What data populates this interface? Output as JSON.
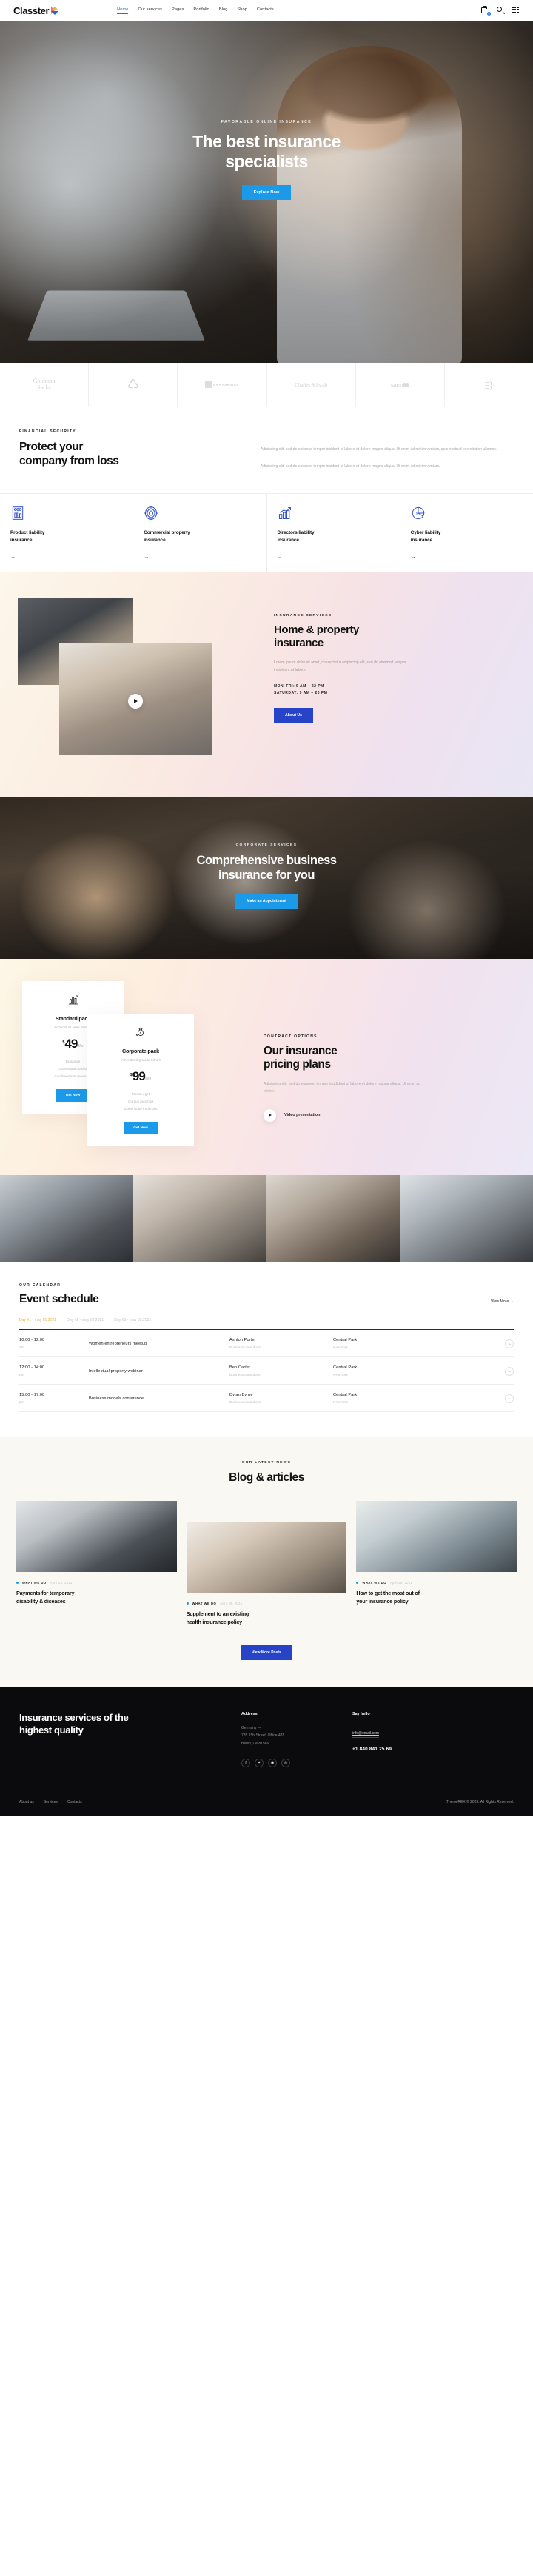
{
  "header": {
    "logo_text": "Classter",
    "nav": [
      {
        "label": "Home",
        "active": true
      },
      {
        "label": "Our services",
        "active": false
      },
      {
        "label": "Pages",
        "active": false
      },
      {
        "label": "Portfolio",
        "active": false
      },
      {
        "label": "Blog",
        "active": false
      },
      {
        "label": "Shop",
        "active": false
      },
      {
        "label": "Contacts",
        "active": false
      }
    ],
    "cart_count": "0",
    "icons": [
      "cart-icon",
      "search-icon",
      "grid-menu-icon"
    ]
  },
  "hero": {
    "kicker": "FAVORABLE ONLINE INSURANCE",
    "title_line1": "The best insurance",
    "title_line2": "specialists",
    "cta": "Explore Now"
  },
  "brands": [
    {
      "name": "Goldman Sachs",
      "line1": "Goldman",
      "line2": "Sachs"
    },
    {
      "name": "recycle-logo",
      "line1": "",
      "line2": ""
    },
    {
      "name": "BNP PARIBAS",
      "line1": "BNP PARIBAS",
      "line2": ""
    },
    {
      "name": "Charles Schwab",
      "line1": "Charles Schwab",
      "line2": ""
    },
    {
      "name": "sam",
      "line1": "sam",
      "line2": ""
    },
    {
      "name": "bars-logo",
      "line1": "",
      "line2": ""
    }
  ],
  "financial": {
    "kicker": "FINANCIAL SECURITY",
    "title_line1": "Protect your",
    "title_line2": "company from loss",
    "para1": "Adipiscing elit, sed do euismod tempor incidunt ut labore et dolore magna aliqua. Ut enim ad minim veniam, quis nostrud exercitation ullamco.",
    "para2": "Adipiscing elit, sed do euismod tempor incidunt ut labore et dolore magna aliqua. Ut enim ad minim veniam.",
    "features": [
      {
        "icon": "chart-bars-money-icon",
        "title_line1": "Product liability",
        "title_line2": "insurance",
        "arrow": "→"
      },
      {
        "icon": "target-dollar-icon",
        "title_line1": "Commercial property",
        "title_line2": "insurance",
        "arrow": "→"
      },
      {
        "icon": "growth-chart-icon",
        "title_line1": "Directors liability",
        "title_line2": "insurance",
        "arrow": "→"
      },
      {
        "icon": "pie-chart-dollar-icon",
        "title_line1": "Cyber liability",
        "title_line2": "insurance",
        "arrow": "→"
      }
    ]
  },
  "home_property": {
    "kicker": "INSURANCE SERVICES",
    "title_line1": "Home & property",
    "title_line2": "insurance",
    "desc": "Lorem ipsum dolor sit amet, consectetur adipiscing elit, sed do eiusmod tempor incididunt ut labore.",
    "hours_line1": "MON–FRI: 9 AM – 22 PM",
    "hours_line2": "SATURDAY: 9 AM – 20 PM",
    "cta": "About Us"
  },
  "corporate": {
    "kicker": "CORPORATE SERVICES",
    "title_line1": "Comprehensive business",
    "title_line2": "insurance for you",
    "cta": "Make an Appointment"
  },
  "pricing": {
    "kicker": "CONTRACT OPTIONS",
    "title_line1": "Our insurance",
    "title_line2": "pricing plans",
    "desc": "Adipiscing elit, sed do eiusmod tempor incididunt ut labore et dolore magna aliqua. Ut enim ad minim.",
    "video_label": "Video presentation",
    "cards": [
      {
        "icon": "bar-chart-icon",
        "title": "Standard pack",
        "subtitle": "Ac tincidunt vitae semper",
        "currency": "$",
        "amount": "49",
        "period": "/Mo",
        "features": [
          "Duis aute",
          "Consequat mauris",
          "Condimentum venenatis"
        ],
        "cta": "Get Now"
      },
      {
        "icon": "money-bag-icon",
        "title": "Corporate pack",
        "subtitle": "In hendrerit gravida rutrum",
        "currency": "$",
        "amount": "99",
        "period": "/Mo",
        "features": [
          "Massa eget",
          "Cursus euismod",
          "Scelerisque imperdiet"
        ],
        "cta": "Get Now"
      }
    ]
  },
  "events": {
    "kicker": "OUR CALENDAR",
    "title": "Event schedule",
    "view_more": "View More  →",
    "days": [
      {
        "label": "Day #1 - may 01.2021",
        "active": true
      },
      {
        "label": "Day #2 - may 02.2021",
        "active": false
      },
      {
        "label": "Day #3 - may 03.2021",
        "active": false
      }
    ],
    "rows": [
      {
        "time": "10:00 - 12:00",
        "ampm": "am",
        "name": "Women entrepreneurs meetup",
        "person": "Ashton Porter",
        "role": "Business consultant",
        "place": "Central Park",
        "city": "New York",
        "arrow": "→"
      },
      {
        "time": "12:00 - 14:00",
        "ampm": "pm",
        "name": "Intellectual property webinar",
        "person": "Ben Carter",
        "role": "Business consultant",
        "place": "Central Park",
        "city": "New York",
        "arrow": "→"
      },
      {
        "time": "15:00 - 17:00",
        "ampm": "pm",
        "name": "Business models conference",
        "person": "Dylan Byrne",
        "role": "Business consultant",
        "place": "Central Park",
        "city": "New York",
        "arrow": "→"
      }
    ]
  },
  "blog": {
    "kicker": "OUR LATEST NEWS",
    "title": "Blog & articles",
    "cta": "View More Posts",
    "posts": [
      {
        "category": "WHAT WE DO",
        "date": "April 26, 2021",
        "title_line1": "Payments for temporary",
        "title_line2": "disability & diseases"
      },
      {
        "category": "WHAT WE DO",
        "date": "April 26, 2021",
        "title_line1": "Supplement to an existing",
        "title_line2": "health insurance policy"
      },
      {
        "category": "WHAT WE DO",
        "date": "April 26, 2021",
        "title_line1": "How to get the most out of",
        "title_line2": "your insurance policy"
      }
    ]
  },
  "footer": {
    "headline_line1": "Insurance services of the",
    "headline_line2": "highest quality",
    "address_title": "Address",
    "address_lines": [
      "Germany —",
      "785 15h Street, Office 478",
      "Berlin, De 81566"
    ],
    "contact_title": "Say hello",
    "email": "info@email.com",
    "phone": "+1 840 841 25 69",
    "socials": [
      "facebook-icon",
      "twitter-icon",
      "dribbble-icon",
      "instagram-icon"
    ],
    "links": [
      "About us",
      "Services",
      "Contacts"
    ],
    "copyright": "ThemeREX © 2023. All Rights Reserved."
  },
  "colors": {
    "accent_cyan": "#1a9ae8",
    "accent_blue": "#2744c9",
    "accent_yellow": "#e8b341",
    "icon_blue": "#3554c9",
    "footer_bg": "#0b0b0d"
  }
}
